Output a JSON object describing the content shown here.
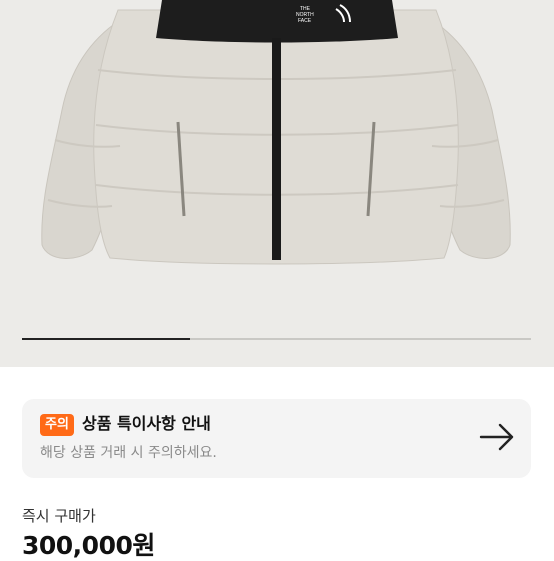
{
  "product_image": {
    "brand_logo_text": "THE NORTH FACE",
    "carousel_progress": 0.33
  },
  "notice": {
    "badge": "주의",
    "title": "상품 특이사항 안내",
    "subtitle": "해당 상품 거래 시 주의하세요."
  },
  "price": {
    "label": "즉시 구매가",
    "value": "300,000원"
  },
  "colors": {
    "accent": "#ff6a17",
    "card_bg": "#f4f4f4",
    "hero_bg": "#ecebe8"
  }
}
